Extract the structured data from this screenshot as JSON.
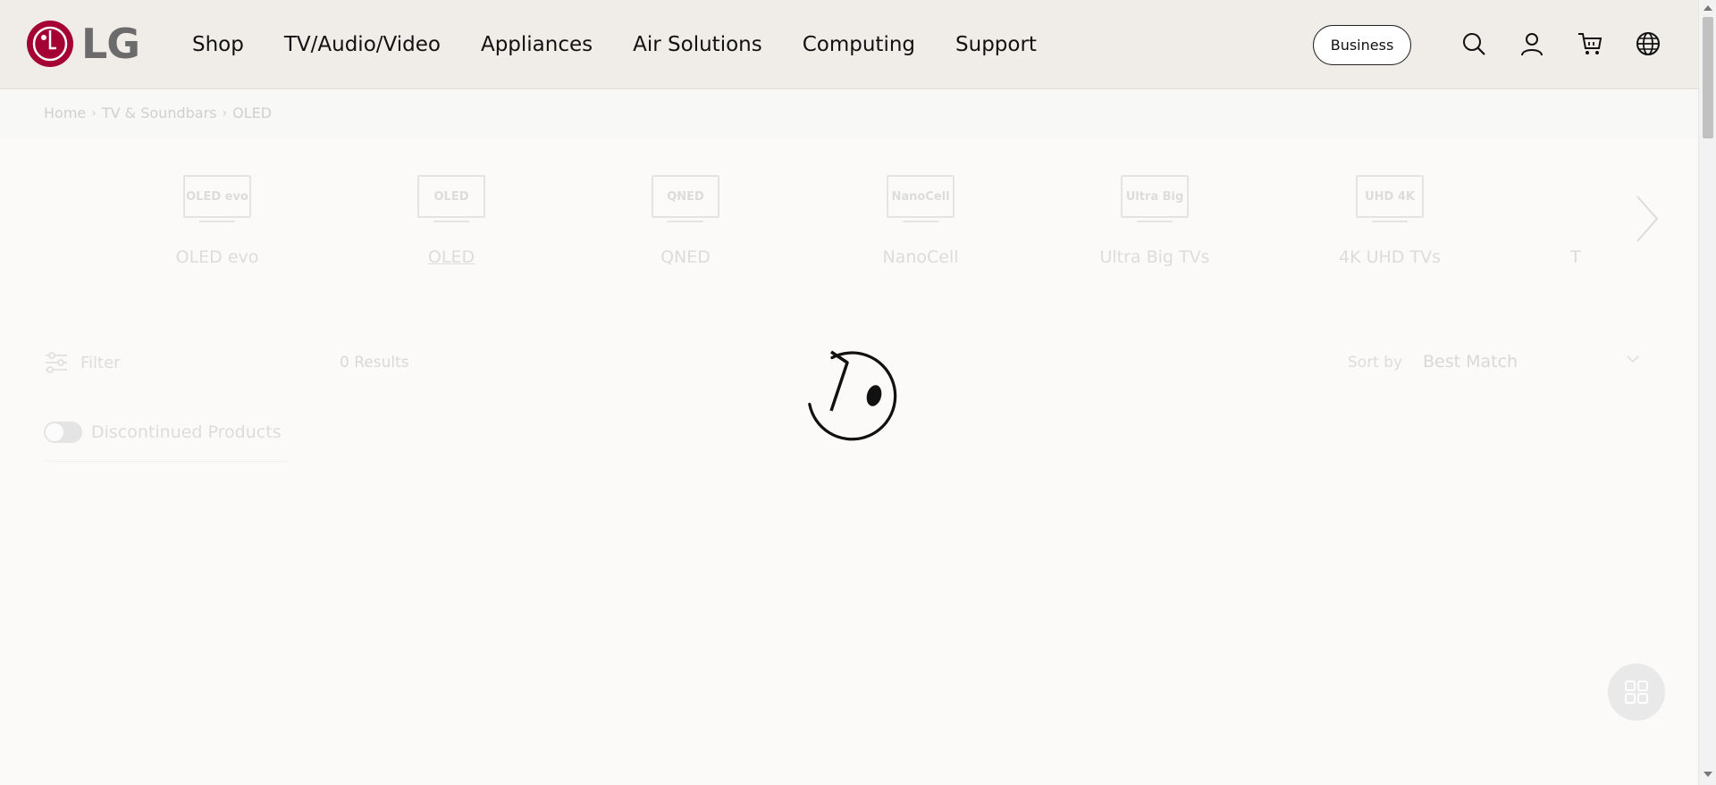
{
  "header": {
    "logo_text": "LG",
    "nav": [
      "Shop",
      "TV/Audio/Video",
      "Appliances",
      "Air Solutions",
      "Computing",
      "Support"
    ],
    "business_label": "Business",
    "icons": [
      "search-icon",
      "user-icon",
      "cart-icon",
      "globe-icon"
    ],
    "brand_color": "#a50034"
  },
  "breadcrumb": [
    "Home",
    "TV & Soundbars",
    "OLED"
  ],
  "categories": [
    {
      "icon_text": "OLED evo",
      "label": "OLED evo"
    },
    {
      "icon_text": "OLED",
      "label": "OLED"
    },
    {
      "icon_text": "QNED",
      "label": "QNED"
    },
    {
      "icon_text": "NanoCell",
      "label": "NanoCell"
    },
    {
      "icon_text": "Ultra Big",
      "label": "Ultra Big TVs"
    },
    {
      "icon_text": "UHD 4K",
      "label": "4K UHD TVs"
    },
    {
      "icon_text": "",
      "label": "T"
    }
  ],
  "listing": {
    "filter_label": "Filter",
    "results": "0 Results",
    "sort_by_label": "Sort by",
    "sort_value": "Best Match",
    "discontinued_label": "Discontinued Products",
    "discontinued_on": false
  },
  "state": {
    "loading": true
  }
}
